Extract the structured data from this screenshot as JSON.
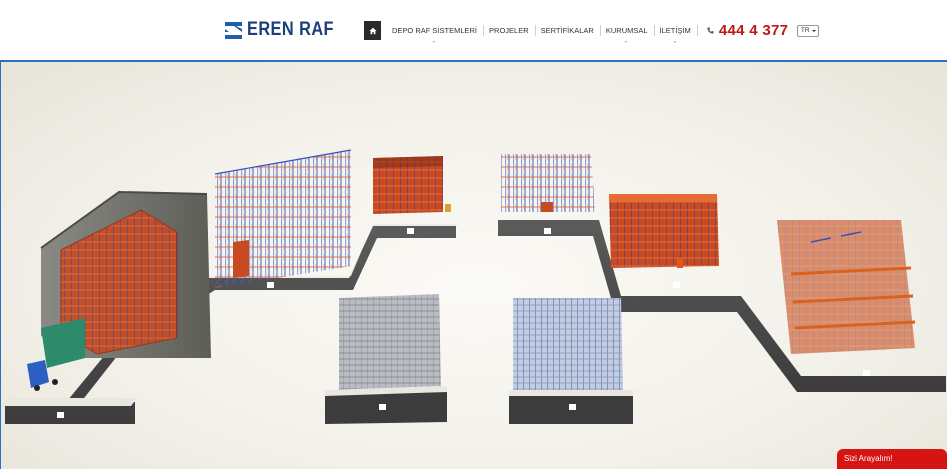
{
  "brand": {
    "name": "EREN RAF",
    "color": "#1c3f7a"
  },
  "nav": {
    "home_icon": "home-icon",
    "items": [
      {
        "label": "DEPO RAF SİSTEMLERİ",
        "has_submenu": true
      },
      {
        "label": "PROJELER",
        "has_submenu": false
      },
      {
        "label": "SERTİFİKALAR",
        "has_submenu": false
      },
      {
        "label": "KURUMSAL",
        "has_submenu": true
      },
      {
        "label": "İLETİŞİM",
        "has_submenu": true
      }
    ]
  },
  "contact": {
    "phone_icon": "phone-icon",
    "phone": "444 4 377",
    "color": "#c01818"
  },
  "language": {
    "selected": "TR"
  },
  "hero": {
    "accent": "#2f6fc0",
    "illustration": "warehouse-racking-systems-3d"
  },
  "call_me": {
    "label": "Sizi Arayalım!",
    "color": "#d61414"
  }
}
